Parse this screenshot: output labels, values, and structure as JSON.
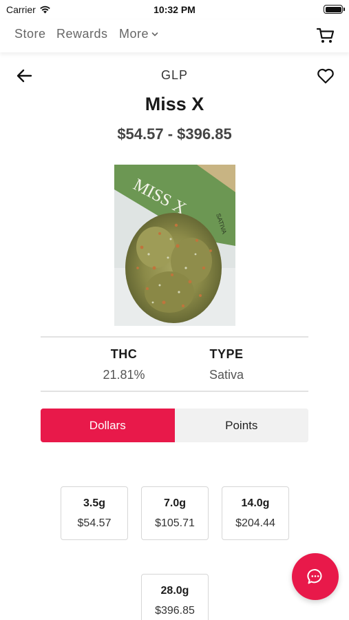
{
  "status_bar": {
    "carrier": "Carrier",
    "time": "10:32 PM",
    "icons": [
      "wifi-icon",
      "battery-icon"
    ]
  },
  "nav": {
    "store": "Store",
    "rewards": "Rewards",
    "more": "More",
    "icons": [
      "chevron-down-icon",
      "cart-icon"
    ]
  },
  "product": {
    "brand": "GLP",
    "name": "Miss X",
    "price_range": "$54.57 - $396.85",
    "image_label_text": "MISS X",
    "image_side_text": "SATIVA",
    "info": {
      "thc_label": "THC",
      "thc_value": "21.81%",
      "type_label": "TYPE",
      "type_value": "Sativa"
    }
  },
  "pricing_toggle": {
    "dollars_label": "Dollars",
    "points_label": "Points",
    "selected": "Dollars"
  },
  "options": [
    {
      "weight": "3.5g",
      "price": "$54.57"
    },
    {
      "weight": "7.0g",
      "price": "$105.71"
    },
    {
      "weight": "14.0g",
      "price": "$204.44"
    },
    {
      "weight": "28.0g",
      "price": "$396.85"
    }
  ],
  "icons": {
    "back": "arrow-left-icon",
    "favorite": "heart-icon",
    "chat": "chat-bubble-icon"
  },
  "colors": {
    "accent": "#e8194a",
    "toggle_inactive": "#f1f1f1",
    "nav_text": "#666666"
  }
}
